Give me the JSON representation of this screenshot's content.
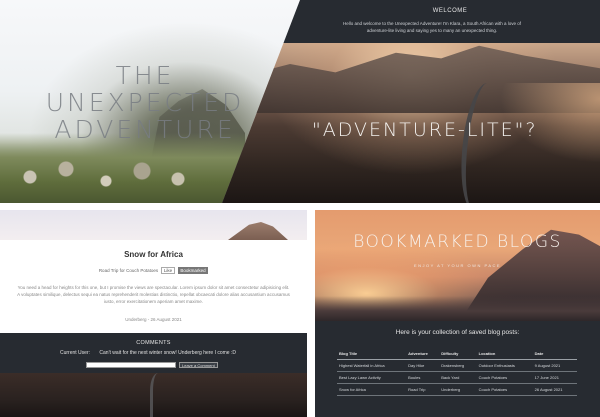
{
  "hero": {
    "title_line1": "THE UNEXPECTED",
    "title_line2": "ADVENTURE"
  },
  "welcome": {
    "title": "WELCOME",
    "text": "Hello and welcome to the Unexpected Adventure! I'm Klara, a South African with a love of adventure-lite living and saying yes to many an unexpected thing."
  },
  "road": {
    "tagline": "\"ADVENTURE-LITE\"?"
  },
  "post": {
    "title": "Snow for Africa",
    "category": "Road Trip for Couch Potatoes",
    "tags": [
      "Like",
      "Bookmarked"
    ],
    "body": "You need a head for heights for this one, but I promise the views are spectacular. Lorem ipsum dolor sit amet consectetur adipisicing elit. A voluptates similique, delectus sequi ea natus reprehenderit molestias distinctio, repellat obcaecati dolore alias accusantium accusamus iusto, error exercitationem aperiam amet maxime.",
    "location": "Underberg",
    "date": "26 August 2021"
  },
  "comments": {
    "title": "COMMENTS",
    "user_label": "Current User:",
    "comment": "Can't wait for the next winter snow! Underberg here I come :D",
    "input_placeholder": "",
    "submit_label": "Leave a Comment"
  },
  "bookmarks": {
    "title": "BOOKMARKED BLOGS",
    "subtitle": "ENJOY AT YOUR OWN PACE",
    "intro": "Here is your collection of saved blog posts:",
    "columns": [
      "Blog Title",
      "Adventure",
      "Difficulty",
      "Location",
      "Date"
    ],
    "rows": [
      [
        "Highest Waterfall in Africa",
        "Day Hike",
        "Drakensberg",
        "Outdoor Enthusiasts",
        "9 August 2021"
      ],
      [
        "Best Lazy Lawn Activity",
        "Boules",
        "Back Yard",
        "Couch Potatoes",
        "17 June 2021"
      ],
      [
        "Snow for Africa",
        "Road Trip",
        "Underberg",
        "Couch Potatoes",
        "26 August 2021"
      ]
    ]
  }
}
